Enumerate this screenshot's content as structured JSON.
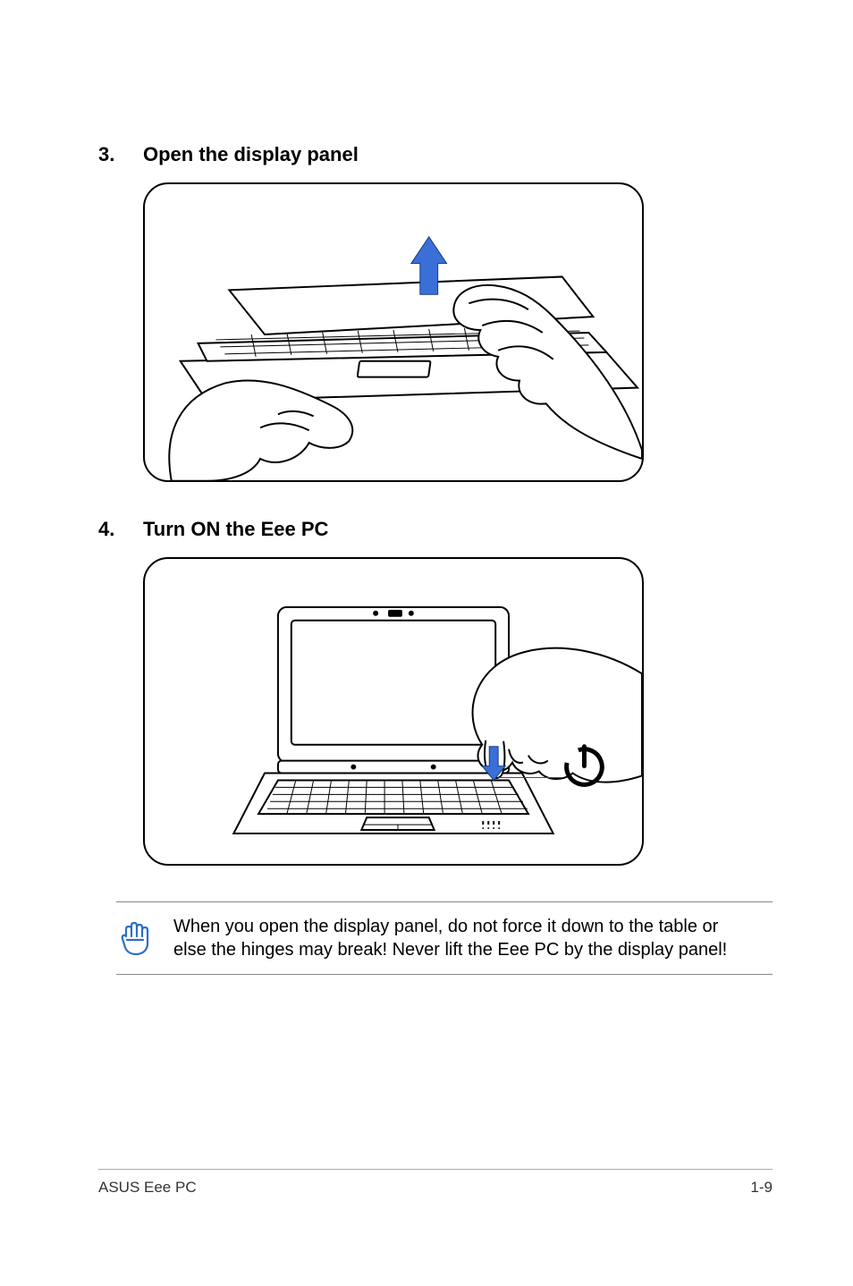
{
  "steps": [
    {
      "num": "3.",
      "title": "Open the display panel"
    },
    {
      "num": "4.",
      "title": "Turn ON the Eee PC"
    }
  ],
  "note": {
    "text": "When you open the display panel, do not force it down to the table or else the hinges may break! Never lift the Eee PC by the display panel!"
  },
  "footer": {
    "left": "ASUS Eee PC",
    "right": "1-9"
  }
}
